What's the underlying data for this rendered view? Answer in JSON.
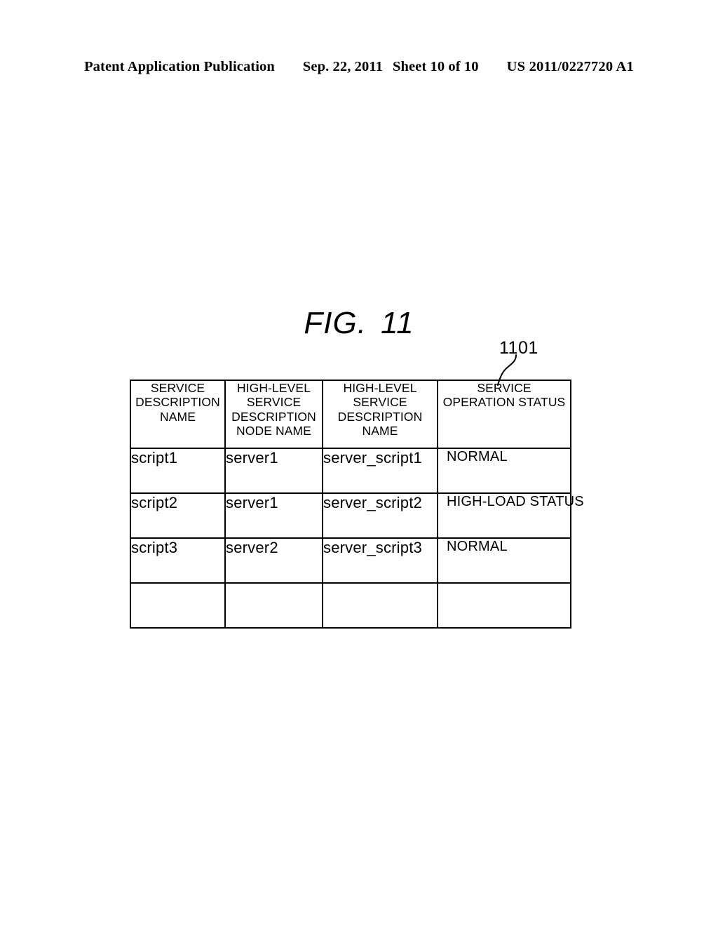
{
  "header": {
    "publication": "Patent Application Publication",
    "date": "Sep. 22, 2011",
    "sheet": "Sheet 10 of 10",
    "patent_number": "US 2011/0227720 A1"
  },
  "figure": {
    "label_prefix": "FIG.",
    "label_number": "11",
    "reference_numeral": "1101"
  },
  "table": {
    "columns": [
      {
        "header": "SERVICE\nDESCRIPTION\nNAME"
      },
      {
        "header": "HIGH-LEVEL\nSERVICE\nDESCRIPTION\nNODE NAME"
      },
      {
        "header": "HIGH-LEVEL\nSERVICE\nDESCRIPTION\nNAME"
      },
      {
        "header": "SERVICE\nOPERATION STATUS"
      }
    ],
    "rows": [
      {
        "service_description_name": "script1",
        "high_level_service_description_node_name": "server1",
        "high_level_service_description_name": "server_script1",
        "service_operation_status": "NORMAL"
      },
      {
        "service_description_name": "script2",
        "high_level_service_description_node_name": "server1",
        "high_level_service_description_name": "server_script2",
        "service_operation_status": "HIGH-LOAD STATUS"
      },
      {
        "service_description_name": "script3",
        "high_level_service_description_node_name": "server2",
        "high_level_service_description_name": "server_script3",
        "service_operation_status": "NORMAL"
      },
      {
        "service_description_name": "",
        "high_level_service_description_node_name": "",
        "high_level_service_description_name": "",
        "service_operation_status": ""
      }
    ]
  },
  "colors": {
    "ink": "#000000",
    "page": "#ffffff"
  }
}
